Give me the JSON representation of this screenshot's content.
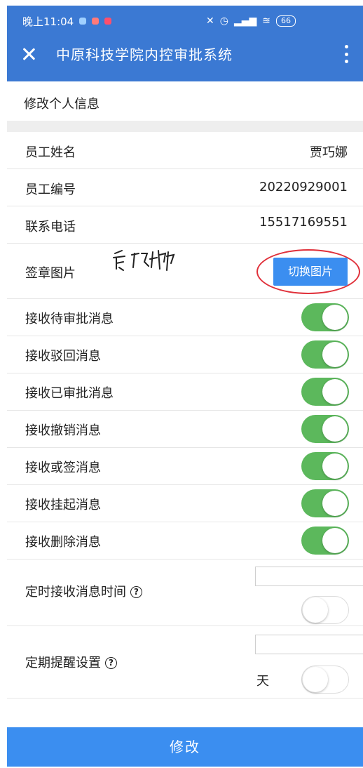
{
  "status_bar": {
    "time": "晚上11:04",
    "battery": "66"
  },
  "app": {
    "title": "中原科技学院内控审批系统"
  },
  "section": {
    "title": "修改个人信息"
  },
  "info_rows": [
    {
      "label": "员工姓名",
      "value": "贾巧娜"
    },
    {
      "label": "员工编号",
      "value": "20220929001"
    },
    {
      "label": "联系电话",
      "value": "15517169551"
    }
  ],
  "signature": {
    "label": "签章图片",
    "signature_text": "贾巧娜",
    "button_label": "切换图片"
  },
  "toggles": [
    {
      "label": "接收待审批消息",
      "on": true
    },
    {
      "label": "接收驳回消息",
      "on": true
    },
    {
      "label": "接收已审批消息",
      "on": true
    },
    {
      "label": "接收撤销消息",
      "on": true
    },
    {
      "label": "接收或签消息",
      "on": true
    },
    {
      "label": "接收挂起消息",
      "on": true
    },
    {
      "label": "接收删除消息",
      "on": true
    }
  ],
  "timed_receive": {
    "label": "定时接收消息时间",
    "help_icon": "question-circle-icon",
    "value": "",
    "on": false
  },
  "reminder": {
    "label": "定期提醒设置",
    "help_icon": "question-circle-icon",
    "value": "",
    "unit": "天",
    "on": false
  },
  "submit": {
    "label": "修改"
  },
  "colors": {
    "primary": "#3b79d3",
    "button": "#3b8ef0",
    "toggle_on": "#5cb85c",
    "annotation": "#e0303a"
  }
}
